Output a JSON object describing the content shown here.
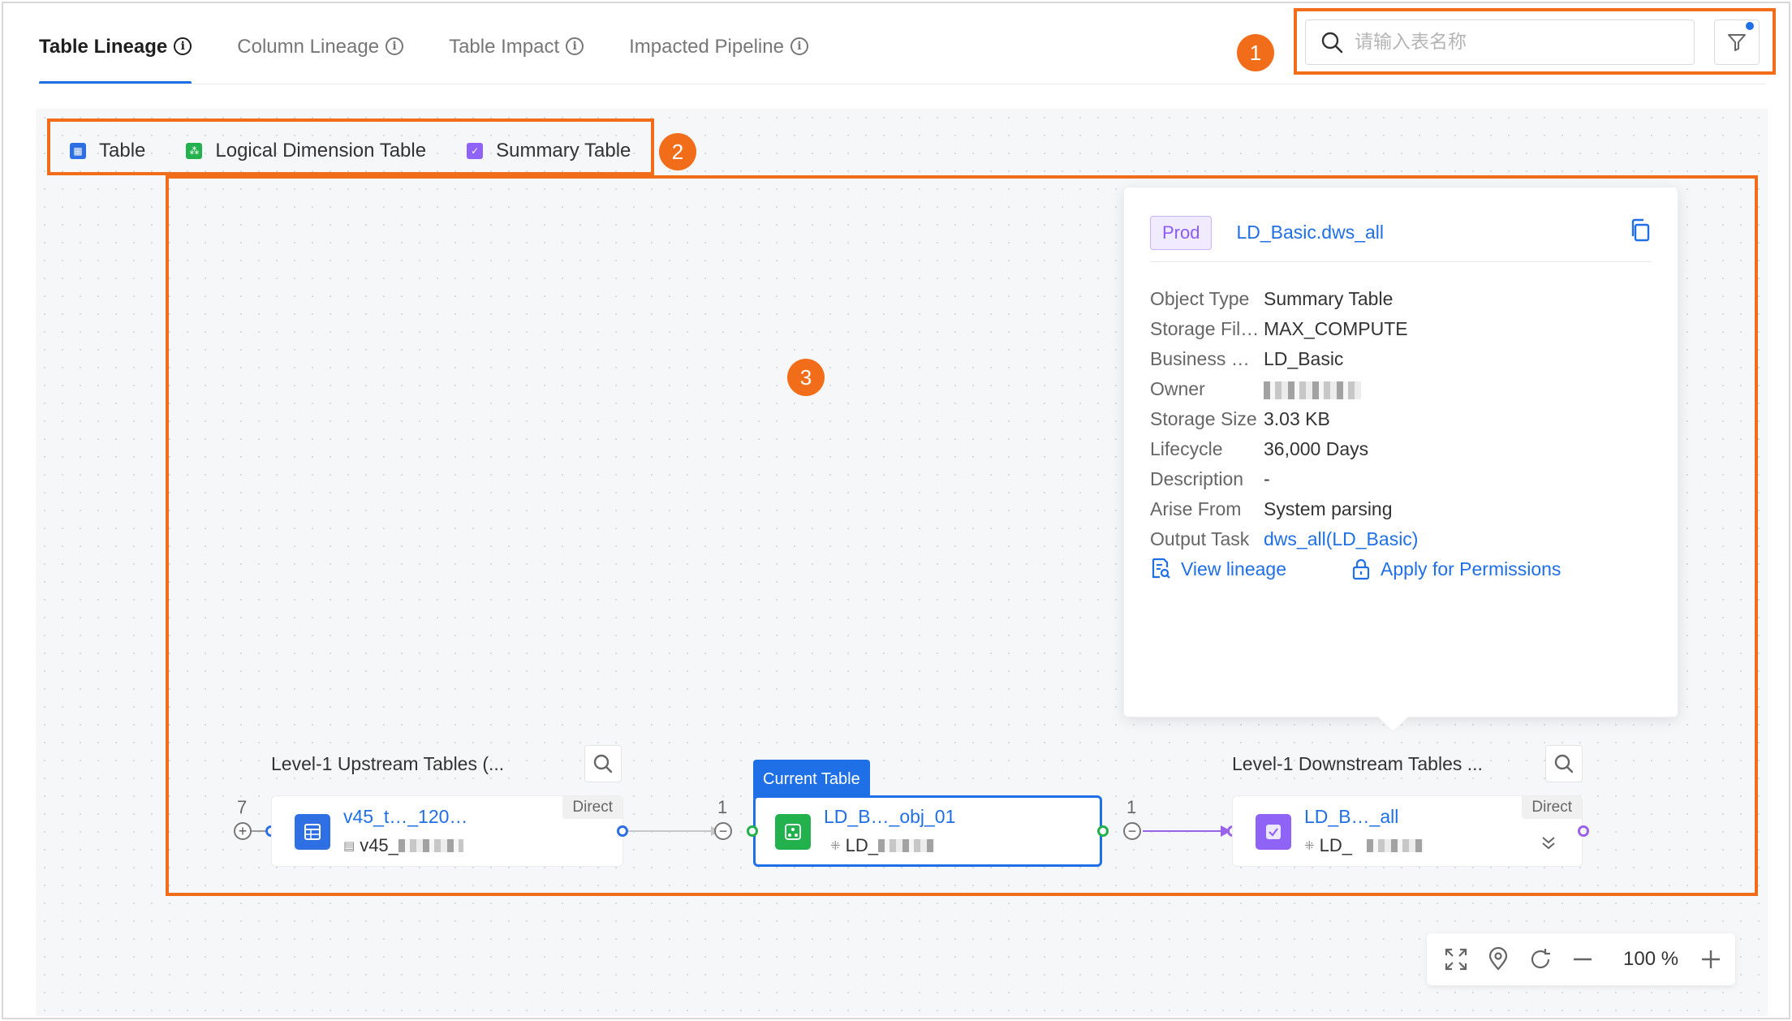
{
  "tabs": [
    {
      "label": "Table Lineage",
      "active": true
    },
    {
      "label": "Column Lineage",
      "active": false
    },
    {
      "label": "Table Impact",
      "active": false
    },
    {
      "label": "Impacted Pipeline",
      "active": false
    }
  ],
  "search": {
    "placeholder": "请输入表名称"
  },
  "legend": [
    {
      "label": "Table",
      "color": "#2f6fe4"
    },
    {
      "label": "Logical Dimension Table",
      "color": "#22b14c"
    },
    {
      "label": "Summary Table",
      "color": "#8f63f5"
    }
  ],
  "annotations": [
    "1",
    "2",
    "3"
  ],
  "detail": {
    "env": "Prod",
    "title": "LD_Basic.dws_all",
    "fields": [
      {
        "label": "Object Type",
        "value": "Summary Table"
      },
      {
        "label": "Storage Fil…",
        "value": "MAX_COMPUTE"
      },
      {
        "label": "Business …",
        "value": "LD_Basic"
      },
      {
        "label": "Owner",
        "value": ""
      },
      {
        "label": "Storage Size",
        "value": "3.03 KB"
      },
      {
        "label": "Lifecycle",
        "value": "36,000 Days"
      },
      {
        "label": "Description",
        "value": "-"
      },
      {
        "label": "Arise From",
        "value": "System parsing"
      },
      {
        "label": "Output Task",
        "value": "dws_all(LD_Basic)"
      }
    ],
    "actions": {
      "view_lineage": "View lineage",
      "apply_permissions": "Apply for Permissions"
    }
  },
  "lineage": {
    "upstream": {
      "title": "Level-1 Upstream Tables (...",
      "count": "7",
      "node": {
        "name": "v45_t…_120…",
        "sub": "v45_",
        "tag": "Direct"
      }
    },
    "current": {
      "tag": "Current Table",
      "count_in": "1",
      "node": {
        "name": "LD_B…_obj_01",
        "sub": "LD_"
      }
    },
    "downstream": {
      "title": "Level-1 Downstream Tables ...",
      "count": "1",
      "node": {
        "name": "LD_B…_all",
        "sub": "LD_",
        "tag": "Direct"
      }
    }
  },
  "zoom": {
    "value": "100",
    "unit": "%"
  },
  "colors": {
    "accent": "#1f6fe6",
    "annotation": "#f26d1a"
  }
}
